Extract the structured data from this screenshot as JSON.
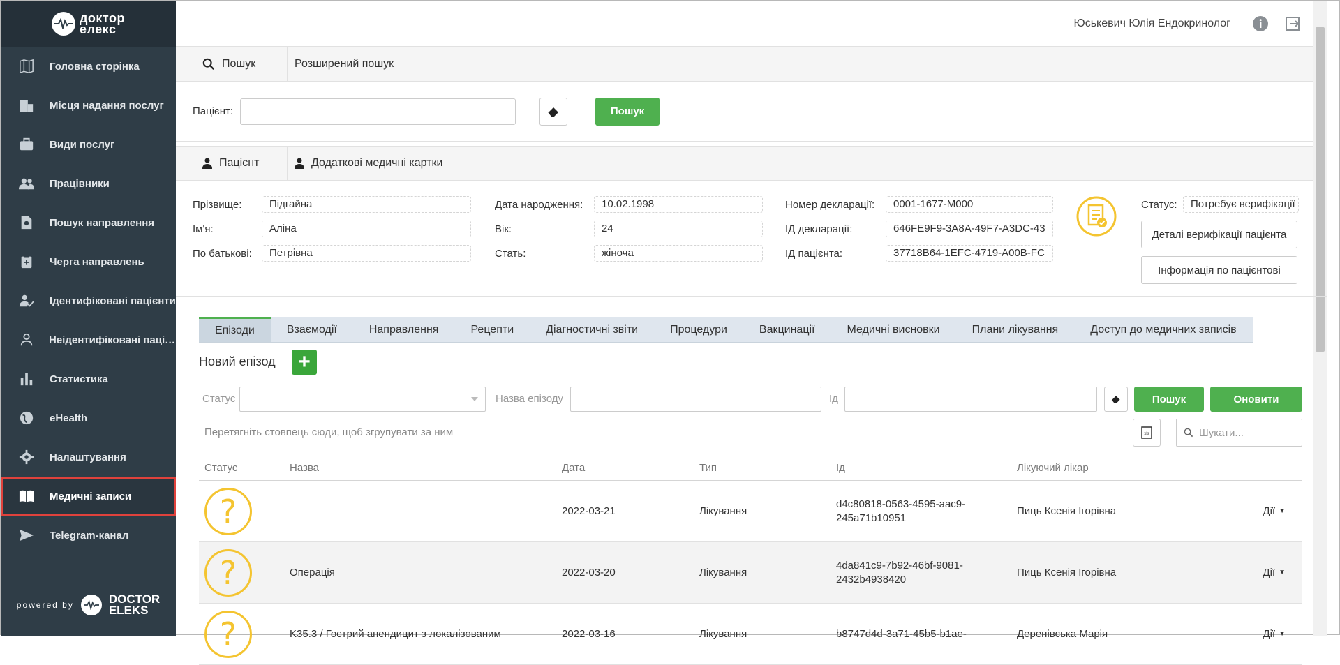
{
  "sidebar": {
    "logo_line1": "доктор",
    "logo_line2": "елекс",
    "items": [
      {
        "label": "Головна сторінка",
        "icon": "map-icon"
      },
      {
        "label": "Місця надання послуг",
        "icon": "building-icon"
      },
      {
        "label": "Види послуг",
        "icon": "briefcase-icon"
      },
      {
        "label": "Працівники",
        "icon": "people-icon"
      },
      {
        "label": "Пошук направлення",
        "icon": "document-search-icon"
      },
      {
        "label": "Черга направлень",
        "icon": "clipboard-icon"
      },
      {
        "label": "Ідентифіковані пацієнти",
        "icon": "person-check-icon"
      },
      {
        "label": "Неідентифіковані пацієнти",
        "icon": "person-icon"
      },
      {
        "label": "Статистика",
        "icon": "bar-chart-icon"
      },
      {
        "label": "eHealth",
        "icon": "globe-icon"
      },
      {
        "label": "Налаштування",
        "icon": "gear-icon"
      },
      {
        "label": "Медичні записи",
        "icon": "book-icon",
        "active": true
      },
      {
        "label": "Telegram-канал",
        "icon": "send-icon"
      }
    ],
    "powered_by": "powered by",
    "powered_logo1": "DOCTOR",
    "powered_logo2": "ELEKS"
  },
  "header": {
    "user": "Юськевич Юлія Ендокринолог",
    "icons": [
      "info-icon",
      "logout-icon"
    ]
  },
  "search_tabs": {
    "search": "Пошук",
    "advanced": "Розширений пошук"
  },
  "search": {
    "patient_label": "Пацієнт:",
    "patient_value": "",
    "button": "Пошук"
  },
  "patient_tabs": {
    "patient": "Пацієнт",
    "cards": "Додаткові медичні картки"
  },
  "patient": {
    "surname_label": "Прізвище:",
    "surname": "Підгайна",
    "name_label": "Ім'я:",
    "name": "Аліна",
    "patronymic_label": "По батькові:",
    "patronymic": "Петрівна",
    "birth_label": "Дата народження:",
    "birth": "10.02.1998",
    "age_label": "Вік:",
    "age": "24",
    "sex_label": "Стать:",
    "sex": "жіноча",
    "decl_num_label": "Номер декларації:",
    "decl_num": "0001-1677-M000",
    "decl_id_label": "ІД декларації:",
    "decl_id": "646FE9F9-3A8A-49F7-A3DC-43",
    "patient_id_label": "ІД пацієнта:",
    "patient_id": "37718B64-1EFC-4719-A00B-FC",
    "status_label": "Статус:",
    "status": "Потребує верифікації",
    "verify_button": "Деталі верифікації пацієнта",
    "info_button": "Інформація по пацієнтові"
  },
  "episode_tabs": [
    "Епізоди",
    "Взаємодії",
    "Направлення",
    "Рецепти",
    "Діагностичні звіти",
    "Процедури",
    "Вакцинації",
    "Медичні висновки",
    "Плани лікування",
    "Доступ до медичних записів"
  ],
  "episodes": {
    "new_label": "Новий епізод",
    "status_label": "Статус",
    "name_label": "Назва епізоду",
    "id_label": "Ід",
    "search_button": "Пошук",
    "refresh_button": "Оновити",
    "group_hint": "Перетягніть стовпець сюди, щоб згрупувати за ним",
    "search_placeholder": "Шукати..."
  },
  "table": {
    "columns": [
      "Статус",
      "Назва",
      "Дата",
      "Тип",
      "Ід",
      "Лікуючий лікар"
    ],
    "action_label": "Дії",
    "rows": [
      {
        "status": "?",
        "name": "",
        "date": "2022-03-21",
        "type": "Лікування",
        "id1": "d4c80818-0563-4595-aac9-",
        "id2": "245a71b10951",
        "doctor": "Пиць Ксенія Ігорівна"
      },
      {
        "status": "?",
        "name": "Операція",
        "date": "2022-03-20",
        "type": "Лікування",
        "id1": "4da841c9-7b92-46bf-9081-",
        "id2": "2432b4938420",
        "doctor": "Пиць Ксенія Ігорівна"
      },
      {
        "status": "?",
        "name": "K35.3 / Гострий апендицит з локалізованим",
        "date": "2022-03-16",
        "type": "Лікування",
        "id1": "b8747d4d-3a71-45b5-b1ae-",
        "id2": "",
        "doctor": "Деренівська Марія"
      }
    ]
  },
  "colors": {
    "sidebar_bg": "#2f3d47",
    "accent_green": "#4fb04f",
    "active_outline": "#e0423c",
    "status_icon": "#f4c430"
  }
}
